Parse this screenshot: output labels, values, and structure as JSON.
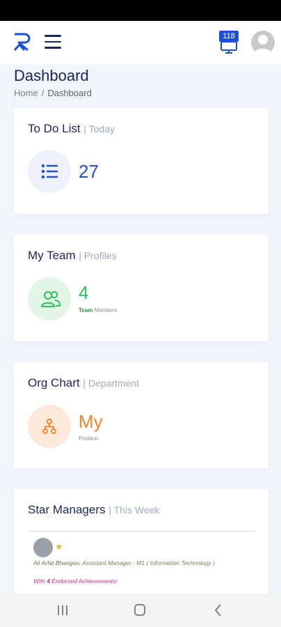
{
  "header": {
    "notification_count": "118",
    "icons": [
      "logo-icon",
      "menu-icon",
      "monitor-icon",
      "avatar-icon"
    ]
  },
  "page": {
    "title": "Dashboard",
    "breadcrumb": {
      "home": "Home",
      "separator": "/",
      "current": "Dashboard"
    }
  },
  "cards": {
    "todo": {
      "title": "To Do List",
      "subtitle": "| Today",
      "value": "27"
    },
    "team": {
      "title": "My Team",
      "subtitle": "| Profiles",
      "value": "4",
      "label_bold": "Team",
      "label_rest": "Members"
    },
    "org": {
      "title": "Org Chart",
      "subtitle": "| Department",
      "value": "My",
      "label": "Position"
    },
    "star": {
      "title": "Star Managers",
      "subtitle": "| This Week",
      "name": "Ali Arfat Bhangoo,",
      "role": "Assistant Manager - M1 ( Information Technology )",
      "achievement_prefix": "With",
      "achievement_count": "4",
      "achievement_suffix": "Endorsed Achievements!"
    }
  },
  "colors": {
    "primary": "#1e4fd8",
    "navy": "#1b2559",
    "green": "#2ec25a",
    "orange": "#f08228",
    "magenta": "#d82a8a"
  }
}
